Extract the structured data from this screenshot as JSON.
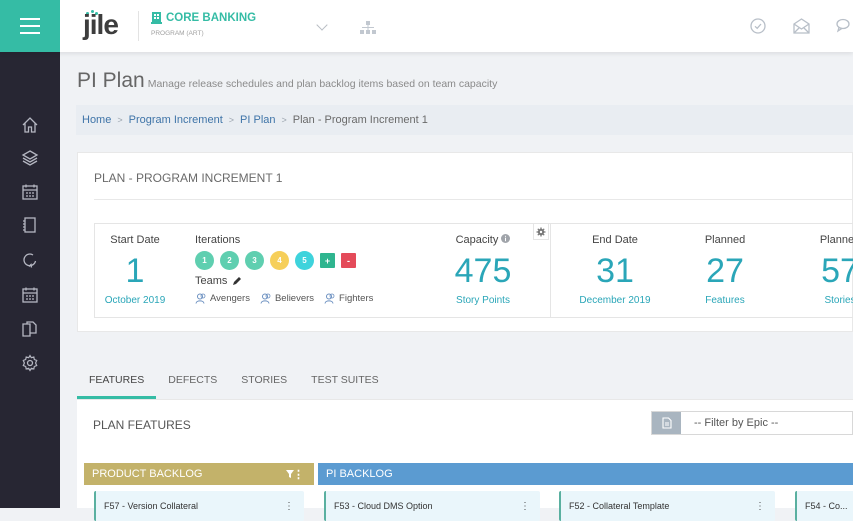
{
  "topbar": {
    "logo": "jile",
    "program_title": "CORE BANKING",
    "program_subtitle": "PROGRAM (ART)",
    "icons": [
      "menu-icon",
      "building-icon",
      "chevron-down-icon",
      "hierarchy-icon",
      "check-circle-icon",
      "envelope-open-icon",
      "chat-icon"
    ]
  },
  "sidebar": {
    "items": [
      {
        "icon": "home-icon"
      },
      {
        "icon": "layers-icon"
      },
      {
        "icon": "calendar-icon"
      },
      {
        "icon": "notebook-icon"
      },
      {
        "icon": "refresh-icon"
      },
      {
        "icon": "calendar-icon"
      },
      {
        "icon": "copy-icon"
      },
      {
        "icon": "gear-icon"
      }
    ]
  },
  "page": {
    "title": "PI Plan",
    "subtitle": "Manage release schedules and plan backlog items based on team capacity"
  },
  "breadcrumb": [
    {
      "label": "Home",
      "link": true
    },
    {
      "label": "Program Increment",
      "link": true
    },
    {
      "label": "PI Plan",
      "link": true
    },
    {
      "label": "Plan - Program Increment 1",
      "link": false
    }
  ],
  "plan": {
    "title": "PLAN - PROGRAM INCREMENT 1",
    "start": {
      "label": "Start Date",
      "value": "1",
      "sub": "October 2019"
    },
    "iterations": {
      "label": "Iterations",
      "items": [
        {
          "label": "1",
          "color": "#5fcfb0"
        },
        {
          "label": "2",
          "color": "#5fcfb0"
        },
        {
          "label": "3",
          "color": "#5fcfb0"
        },
        {
          "label": "4",
          "color": "#f6cf5a"
        },
        {
          "label": "5",
          "color": "#3ed3dc"
        }
      ],
      "add_label": "+",
      "remove_label": "-",
      "add_color": "#2fb58f",
      "remove_color": "#e44b5a"
    },
    "teams": {
      "label": "Teams",
      "items": [
        "Avengers",
        "Believers",
        "Fighters"
      ]
    },
    "capacity": {
      "label": "Capacity",
      "value": "475",
      "sub": "Story Points"
    },
    "end": {
      "label": "End Date",
      "value": "31",
      "sub": "December 2019"
    },
    "planned_features": {
      "label": "Planned",
      "value": "27",
      "sub": "Features"
    },
    "planned_stories": {
      "label": "Planned",
      "value": "57",
      "sub": "Stories"
    }
  },
  "tabs": [
    {
      "label": "FEATURES",
      "active": true
    },
    {
      "label": "DEFECTS",
      "active": false
    },
    {
      "label": "STORIES",
      "active": false
    },
    {
      "label": "TEST SUITES",
      "active": false
    }
  ],
  "features": {
    "title": "PLAN FEATURES",
    "filter_placeholder": "-- Filter by Epic --",
    "columns": [
      {
        "title": "PRODUCT BACKLOG",
        "color": "#c3b26a",
        "cards": [
          "F57 - Version Collateral"
        ]
      },
      {
        "title": "PI BACKLOG",
        "color": "#5b9bd1",
        "cards": [
          "F53 - Cloud DMS Option",
          "F52 - Collateral Template",
          "F54 - Co..."
        ]
      }
    ]
  },
  "colors": {
    "accent": "#35bca5",
    "sidebar": "#272633",
    "stat_value": "#2aa6b8",
    "link": "#3f74a8"
  }
}
